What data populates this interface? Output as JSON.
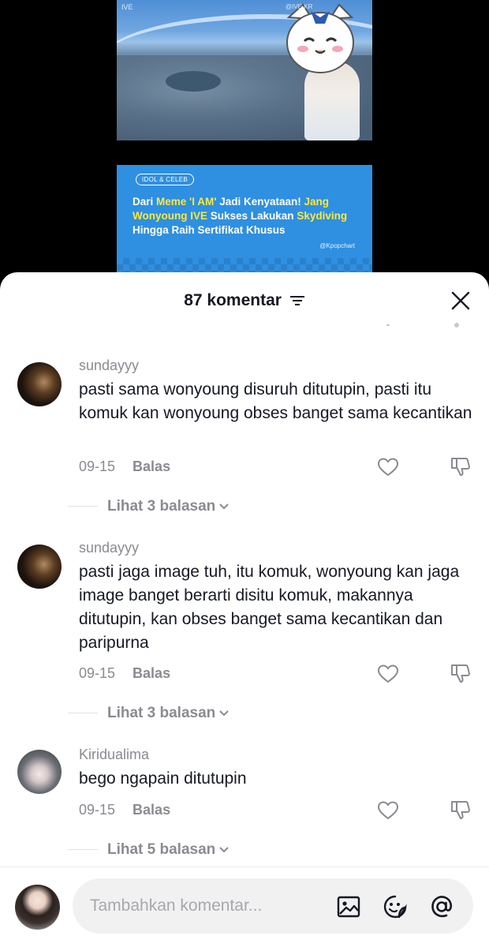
{
  "video": {
    "tag_left": "IVE",
    "tag_right": "@IVE KR",
    "banner": {
      "chip": "IDOL & CELEB",
      "line1_a": "Dari ",
      "line1_b": "Meme 'I AM'",
      "line1_c": " Jadi Kenyataan! ",
      "line1_d": "Jang",
      "line2_a": "Wonyoung IVE",
      "line2_b": " Sukses Lakukan ",
      "line2_c": "Skydiving",
      "line3": "Hingga Raih Sertifikat Khusus",
      "source": "@Kpopchart"
    }
  },
  "header": {
    "title": "87 komentar"
  },
  "comments": [
    {
      "username": "sundayyy",
      "text": "pasti sama wonyoung disuruh ditutupin, pasti itu komuk kan wonyoung obses banget sama kecantikan",
      "date": "09-15",
      "reply_label": "Balas",
      "view_replies": "Lihat 3 balasan"
    },
    {
      "username": "sundayyy",
      "text": "pasti jaga image tuh, itu komuk, wonyoung kan jaga image banget berarti disitu komuk, makannya ditutupin, kan obses banget sama kecantikan dan paripurna",
      "date": "09-15",
      "reply_label": "Balas",
      "view_replies": "Lihat 3 balasan"
    },
    {
      "username": "Kiridualima",
      "text": "bego ngapain ditutupin",
      "date": "09-15",
      "reply_label": "Balas",
      "view_replies": "Lihat 5 balasan"
    }
  ],
  "composer": {
    "placeholder": "Tambahkan komentar..."
  },
  "icons": {
    "filter": "filter-icon",
    "close": "close-icon",
    "like": "heart-icon",
    "dislike": "thumbs-down-icon",
    "chevron": "chevron-down-icon",
    "image": "image-icon",
    "emoji": "emoji-icon",
    "mention": "at-icon"
  },
  "colors": {
    "text_primary": "#161823",
    "text_secondary": "#8a8b91",
    "banner_blue": "#2f8fe0",
    "banner_highlight": "#ffe83a"
  }
}
